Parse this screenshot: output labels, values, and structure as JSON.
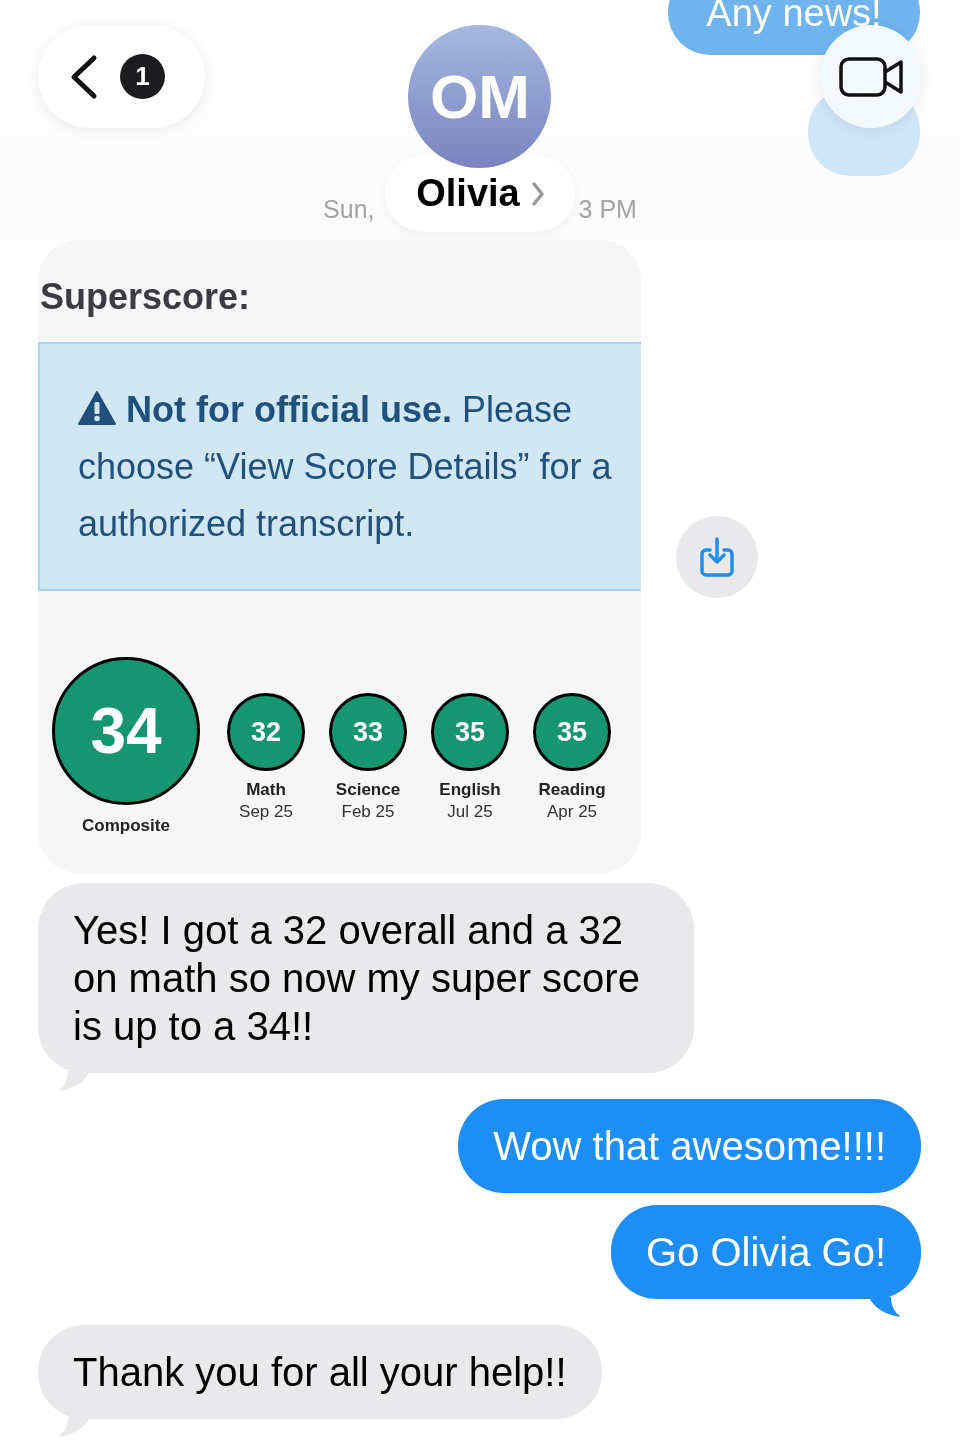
{
  "header": {
    "back_badge": "1",
    "avatar_initials": "OM",
    "contact_name": "Olivia",
    "timestamp": [
      "Sun,",
      "3 PM"
    ],
    "previous_message": "Any news!"
  },
  "messages": [
    {
      "kind": "screenshot",
      "heading": "Superscore:",
      "alert": "**Not for official use.** Please choose “View Score Details” for a authorized transcript.",
      "composite": {
        "score": "34",
        "label": "Composite"
      },
      "sections": [
        {
          "score": "32",
          "name": "Math",
          "date": "Sep 25"
        },
        {
          "score": "33",
          "name": "Science",
          "date": "Feb 25"
        },
        {
          "score": "35",
          "name": "English",
          "date": "Jul 25"
        },
        {
          "score": "35",
          "name": "Reading",
          "date": "Apr 25"
        }
      ]
    },
    {
      "kind": "text",
      "sent": false,
      "text": "Yes! I got a 32 overall and a 32 on math so now my super score is up to a 34!!",
      "tail": true
    },
    {
      "kind": "text",
      "sent": true,
      "text": "Wow that awesome!!!!",
      "tail": false
    },
    {
      "kind": "text",
      "sent": true,
      "text": "Go Olivia Go!",
      "tail": true
    },
    {
      "kind": "text",
      "sent": false,
      "text": "Thank you for all your help!!",
      "tail": true
    }
  ]
}
